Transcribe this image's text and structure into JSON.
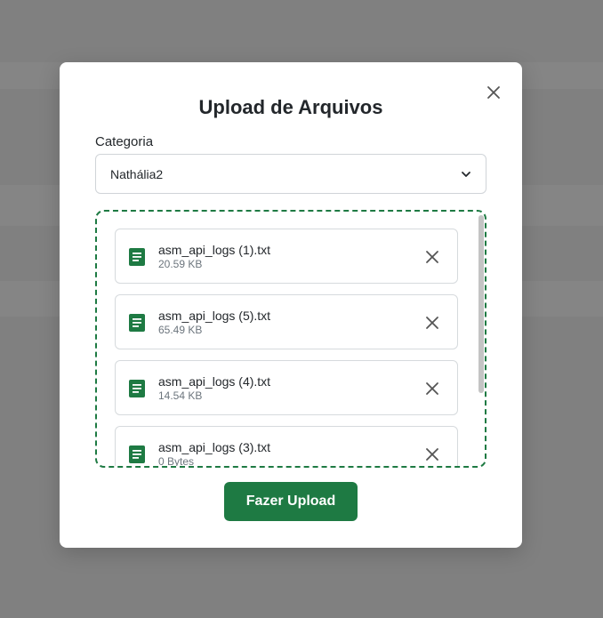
{
  "modal": {
    "title": "Upload de Arquivos",
    "category_label": "Categoria",
    "category_value": "Nathália2",
    "upload_button": "Fazer Upload"
  },
  "files": [
    {
      "name": "asm_api_logs (1).txt",
      "size": "20.59 KB"
    },
    {
      "name": "asm_api_logs (5).txt",
      "size": "65.49 KB"
    },
    {
      "name": "asm_api_logs (4).txt",
      "size": "14.54 KB"
    },
    {
      "name": "asm_api_logs (3).txt",
      "size": "0 Bytes"
    }
  ],
  "colors": {
    "accent": "#1e7a43",
    "overlay": "#808080"
  },
  "icons": {
    "close": "close-icon",
    "file": "file-text-icon",
    "remove": "remove-icon",
    "dropdown": "chevron-down-icon"
  }
}
